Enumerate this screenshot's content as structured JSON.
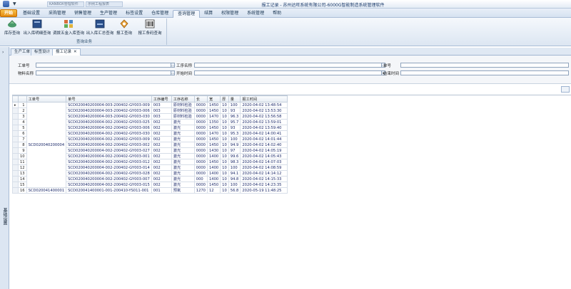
{
  "titlebar": {
    "title": "报工记录 - 苏州达旺系统有限公司-6000G智能制造系统管理软件",
    "quick_access": "▼",
    "window_tabs": [
      "KANBOX管理软件",
      "示例工程报表"
    ]
  },
  "menu": {
    "home": "开始",
    "tabs": [
      "基础设置",
      "采购管理",
      "销售管理",
      "生产管理",
      "标签设置",
      "仓库管理",
      "查询管理",
      "结算",
      "权限管理",
      "系统管理",
      "帮助"
    ],
    "active_index": 6
  },
  "ribbon": {
    "group_label": "查询业务",
    "buttons": [
      "库存查询",
      "出入库明细查询",
      "调拨五金入库查询",
      "出入库汇总查询",
      "报工查询",
      "报工条码查询"
    ]
  },
  "leftdock": {
    "label": "基础设置"
  },
  "doctabs": [
    "生产工单",
    "标签设计",
    "报工记录"
  ],
  "filters": {
    "work_order_label": "工单号",
    "process_name_label": "工序名称",
    "doc_no_label": "单号",
    "material_name_label": "物料名称",
    "start_time_label": "开始时间",
    "end_time_label": "结束时间",
    "picker_glyph": "…",
    "dropdown_glyph": "▾"
  },
  "grid": {
    "columns": [
      "工单号",
      "单号",
      "工序编号",
      "工序名称",
      "长",
      "宽",
      "厚",
      "量",
      "报工时间"
    ],
    "current_marker": "▸",
    "merged_order_1": "SCD020040200004",
    "rows": [
      {
        "n": "1",
        "order": "",
        "doc": "SCD020040200004-003-200402-GY003-009",
        "code": "003",
        "name": "原材料检验",
        "l": "0000",
        "w": "1450",
        "t": "10",
        "q": "100",
        "time": "2020-04-02 13:48:54"
      },
      {
        "n": "2",
        "order": "",
        "doc": "SCD020040200004-003-200402-GY003-006",
        "code": "003",
        "name": "原材料检验",
        "l": "0000",
        "w": "1450",
        "t": "10",
        "q": "93",
        "time": "2020-04-02 13:53:30"
      },
      {
        "n": "3",
        "order": "",
        "doc": "SCD020040200004-003-200402-GY003-030",
        "code": "003",
        "name": "原材料检验",
        "l": "0000",
        "w": "1470",
        "t": "10",
        "q": "96.3",
        "time": "2020-04-02 13:56:58"
      },
      {
        "n": "4",
        "order": "",
        "doc": "SCD020040200004-002-200402-GY003-025",
        "code": "002",
        "name": "激光",
        "l": "0000",
        "w": "1350",
        "t": "10",
        "q": "95.7",
        "time": "2020-04-02 13:59:01"
      },
      {
        "n": "5",
        "order": "",
        "doc": "SCD020040200004-002-200402-GY003-006",
        "code": "002",
        "name": "激光",
        "l": "0000",
        "w": "1450",
        "t": "10",
        "q": "93",
        "time": "2020-04-02 13:59:40"
      },
      {
        "n": "6",
        "order": "",
        "doc": "SCD020040200004-002-200402-GY003-030",
        "code": "002",
        "name": "激光",
        "l": "0000",
        "w": "1470",
        "t": "10",
        "q": "95.3",
        "time": "2020-04-02 14:00:41"
      },
      {
        "n": "7",
        "order": "",
        "doc": "SCD020040200004-002-200402-GY003-009",
        "code": "002",
        "name": "激光",
        "l": "0000",
        "w": "1450",
        "t": "10",
        "q": "100",
        "time": "2020-04-02 14:01:44"
      },
      {
        "n": "8",
        "order": "",
        "doc": "SCD020040200004-002-200402-GY003-002",
        "code": "002",
        "name": "激光",
        "l": "0000",
        "w": "1450",
        "t": "10",
        "q": "94.9",
        "time": "2020-04-02 14:02:40"
      },
      {
        "n": "9",
        "order": "",
        "doc": "SCD020040200004-002-200402-GY003-027",
        "code": "002",
        "name": "激光",
        "l": "0000",
        "w": "1430",
        "t": "10",
        "q": "97",
        "time": "2020-04-02 14:05:19"
      },
      {
        "n": "10",
        "order": "",
        "doc": "SCD020040200004-002-200402-GY003-001",
        "code": "002",
        "name": "激光",
        "l": "0000",
        "w": "1400",
        "t": "10",
        "q": "99.6",
        "time": "2020-04-02 14:05:43"
      },
      {
        "n": "11",
        "order": "",
        "doc": "SCD020040200004-002-200402-GY003-012",
        "code": "002",
        "name": "激光",
        "l": "0000",
        "w": "1450",
        "t": "10",
        "q": "98.3",
        "time": "2020-04-02 14:07:03"
      },
      {
        "n": "12",
        "order": "",
        "doc": "SCD020040200004-002-200402-GY003-014",
        "code": "002",
        "name": "激光",
        "l": "0000",
        "w": "1400",
        "t": "10",
        "q": "100",
        "time": "2020-04-02 14:08:59"
      },
      {
        "n": "13",
        "order": "",
        "doc": "SCD020040200004-002-200402-GY003-028",
        "code": "002",
        "name": "激光",
        "l": "0000",
        "w": "1400",
        "t": "10",
        "q": "94.1",
        "time": "2020-04-02 14:14:12"
      },
      {
        "n": "14",
        "order": "",
        "doc": "SCD020040200004-002-200402-GY003-007",
        "code": "002",
        "name": "激光",
        "l": "000",
        "w": "1400",
        "t": "10",
        "q": "94.8",
        "time": "2020-04-02 14:15:33"
      },
      {
        "n": "15",
        "order": "",
        "doc": "SCD020040200004-002-200402-GY003-015",
        "code": "002",
        "name": "激光",
        "l": "0000",
        "w": "1450",
        "t": "10",
        "q": "100",
        "time": "2020-04-02 14:23:35"
      },
      {
        "n": "16",
        "order": "SCD020041400001",
        "doc": "SCD020041400001-001-200410-YS011-001",
        "code": "001",
        "name": "预氧",
        "l": "1270",
        "w": "12",
        "t": "10",
        "q": "56.8",
        "time": "2020-05-19 11:48:25"
      }
    ]
  }
}
